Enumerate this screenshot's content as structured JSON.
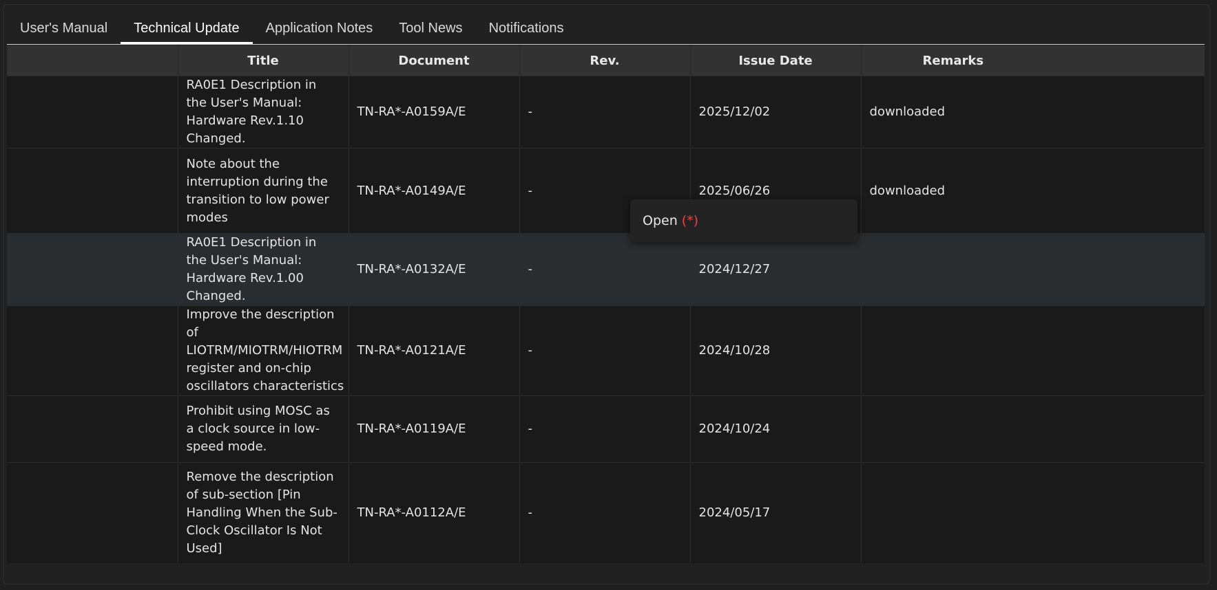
{
  "tabs": [
    {
      "label": "User's Manual",
      "active": false
    },
    {
      "label": "Technical Update",
      "active": true
    },
    {
      "label": "Application Notes",
      "active": false
    },
    {
      "label": "Tool News",
      "active": false
    },
    {
      "label": "Notifications",
      "active": false
    }
  ],
  "table": {
    "headers": [
      "",
      "Title",
      "Document",
      "Rev.",
      "Issue Date",
      "Remarks"
    ],
    "rows": [
      {
        "title": "RA0E1 Description in the User's Manual: Hardware Rev.1.10 Changed.",
        "document": "TN-RA*-A0159A/E",
        "rev": "-",
        "issue_date": "2025/12/02",
        "remarks": "downloaded"
      },
      {
        "title": "Note about the interruption during the transition to low power modes",
        "document": "TN-RA*-A0149A/E",
        "rev": "-",
        "issue_date": "2025/06/26",
        "remarks": "downloaded"
      },
      {
        "title": "RA0E1 Description in the User's Manual: Hardware Rev.1.00 Changed.",
        "document": "TN-RA*-A0132A/E",
        "rev": "-",
        "issue_date": "2024/12/27",
        "remarks": ""
      },
      {
        "title": "Improve the description of LIOTRM/MIOTRM/HIOTRM register and on-chip oscillators characteristics",
        "document": "TN-RA*-A0121A/E",
        "rev": "-",
        "issue_date": "2024/10/28",
        "remarks": ""
      },
      {
        "title": "Prohibit using MOSC as a clock source in low-speed mode.",
        "document": "TN-RA*-A0119A/E",
        "rev": "-",
        "issue_date": "2024/10/24",
        "remarks": ""
      },
      {
        "title": "Remove the description of sub-section [Pin Handling When the Sub-Clock Oscillator Is Not Used]",
        "document": "TN-RA*-A0112A/E",
        "rev": "-",
        "issue_date": "2024/05/17",
        "remarks": ""
      }
    ]
  },
  "context_menu": {
    "label": "Open",
    "marker": "(*)",
    "marker_color": "#ff3b3b"
  },
  "colors": {
    "background": "#1f1f1f",
    "header_bg": "#323232",
    "row_bg": "#1a1a1a",
    "highlight_row_bg": "#2a2d2f"
  }
}
